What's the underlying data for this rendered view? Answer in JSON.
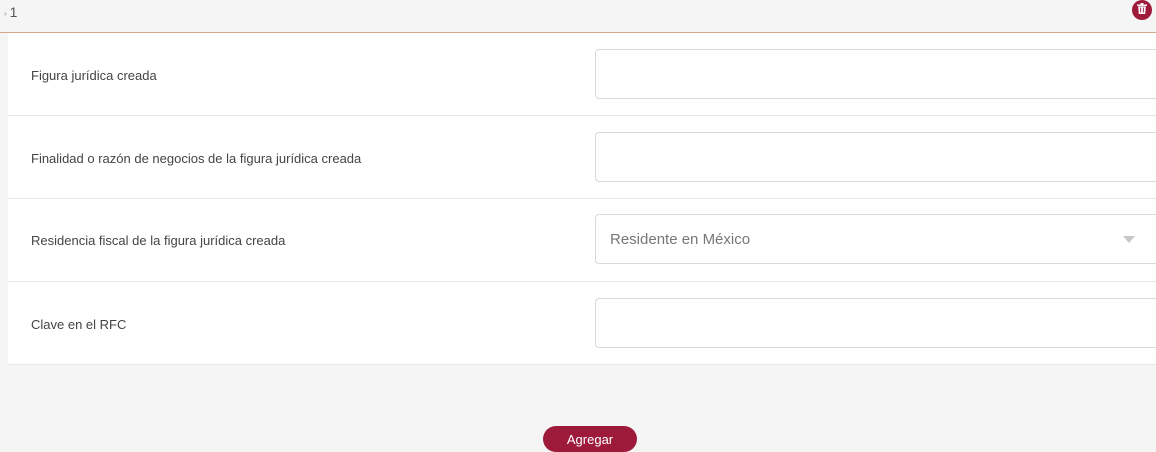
{
  "section": {
    "index_label": "1",
    "delete_icon": "trash-icon"
  },
  "form": {
    "fields": [
      {
        "label": "Figura jurídica creada",
        "value": "",
        "type": "text"
      },
      {
        "label": "Finalidad o razón de negocios de la figura jurídica creada",
        "value": "",
        "type": "text"
      },
      {
        "label": "Residencia fiscal de la figura jurídica creada",
        "value": "Residente en México",
        "type": "select"
      },
      {
        "label": "Clave en el RFC",
        "value": "",
        "type": "text"
      }
    ]
  },
  "actions": {
    "add_label": "Agregar"
  },
  "colors": {
    "accent": "#9d1a3b",
    "divider": "#d8a58a"
  }
}
